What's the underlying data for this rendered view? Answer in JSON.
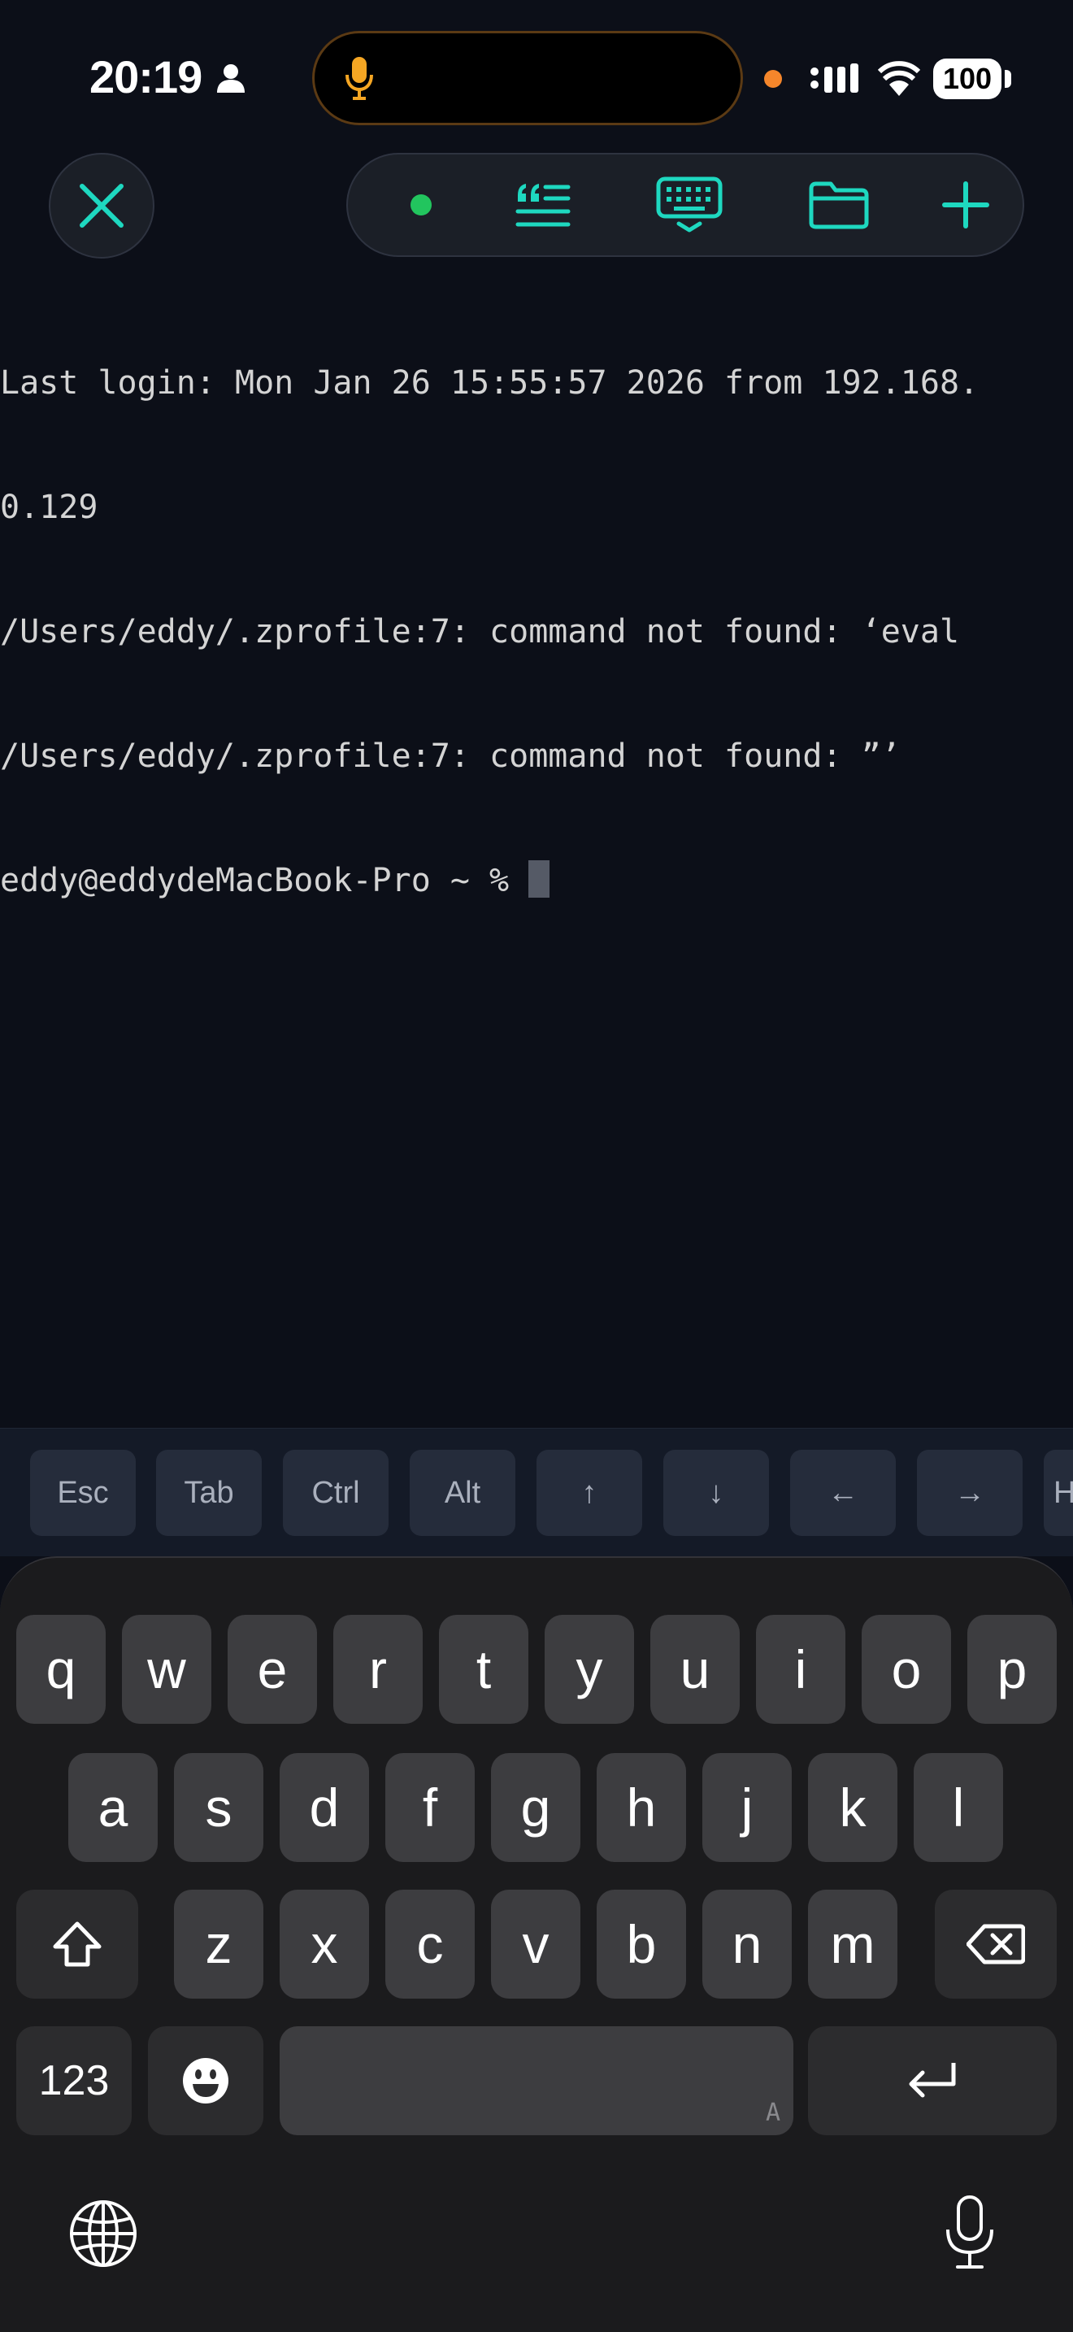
{
  "status_bar": {
    "time": "20:19",
    "battery": "100",
    "icons": [
      "person-icon",
      "mic-icon",
      "orange-dot",
      "cellular-icon",
      "wifi-icon",
      "battery-icon"
    ]
  },
  "toolbar": {
    "close_icon": "close-icon",
    "items": [
      "connection-status-dot",
      "snippets-icon",
      "keyboard-icon",
      "folder-icon",
      "plus-icon"
    ],
    "accent": "#1ed8c0",
    "status_color": "#22c55e"
  },
  "terminal": {
    "lines": [
      "Last login: Mon Jan 26 15:55:57 2026 from 192.168.",
      "0.129",
      "/Users/eddy/.zprofile:7: command not found: ‘eval",
      "/Users/eddy/.zprofile:7: command not found: ”’",
      "eddy@eddydeMacBook‐Pro ~ % "
    ]
  },
  "extra_keys": [
    "Esc",
    "Tab",
    "Ctrl",
    "Alt",
    "↑",
    "↓",
    "←",
    "→",
    "H"
  ],
  "keyboard": {
    "row1": [
      "q",
      "w",
      "e",
      "r",
      "t",
      "y",
      "u",
      "i",
      "o",
      "p"
    ],
    "row2": [
      "a",
      "s",
      "d",
      "f",
      "g",
      "h",
      "j",
      "k",
      "l"
    ],
    "row3": [
      "z",
      "x",
      "c",
      "v",
      "b",
      "n",
      "m"
    ],
    "numbers_label": "123",
    "space_hint": "A",
    "icons": [
      "shift-icon",
      "backspace-icon",
      "emoji-icon",
      "return-icon",
      "globe-icon",
      "dictation-mic-icon"
    ]
  }
}
